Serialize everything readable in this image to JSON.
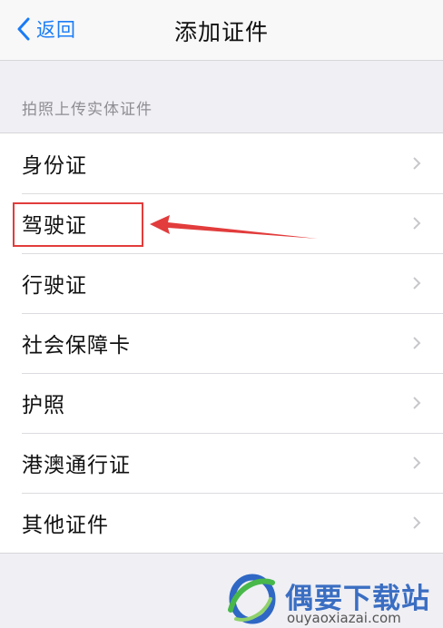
{
  "nav": {
    "back_label": "返回",
    "title": "添加证件"
  },
  "section": {
    "header": "拍照上传实体证件"
  },
  "documents": [
    {
      "label": "身份证"
    },
    {
      "label": "驾驶证"
    },
    {
      "label": "行驶证"
    },
    {
      "label": "社会保障卡"
    },
    {
      "label": "护照"
    },
    {
      "label": "港澳通行证"
    },
    {
      "label": "其他证件"
    }
  ],
  "annotation": {
    "highlighted_item": "驾驶证",
    "color": "#e23c3c"
  },
  "watermark": {
    "name": "偶要下载站",
    "url": "ouyaoxiazai.com"
  },
  "colors": {
    "accent": "#1a7cf6",
    "background": "#efeff4",
    "chevron": "#c7c7cc"
  },
  "icons": {
    "back": "chevron-left-icon",
    "row": "chevron-right-icon"
  }
}
